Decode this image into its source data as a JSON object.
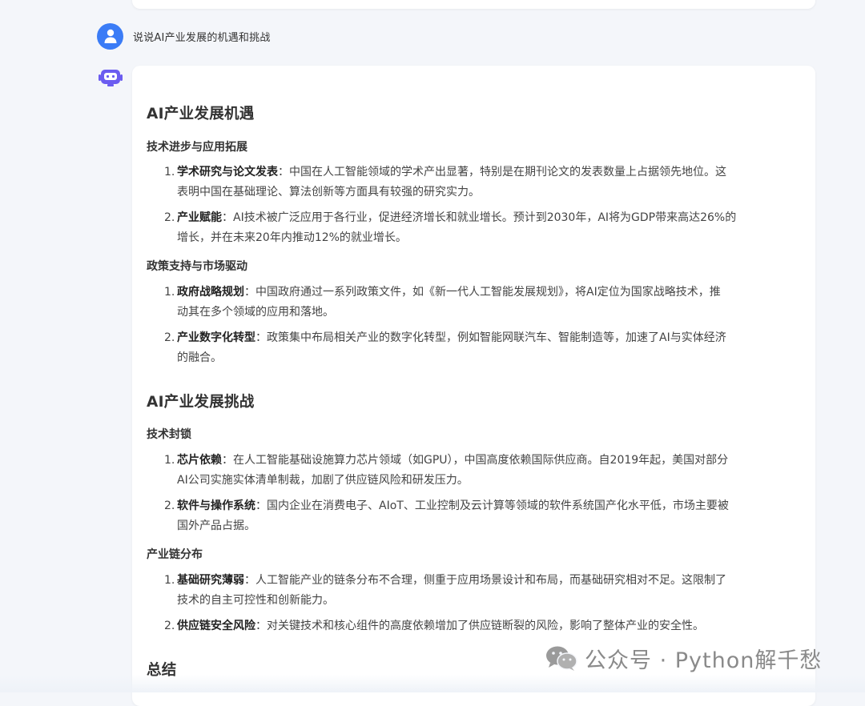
{
  "user_message": "说说AI产业发展的机遇和挑战",
  "answer": {
    "section1_title": "AI产业发展机遇",
    "sub1": "技术进步与应用拓展",
    "s1_i1_bold": "学术研究与论文发表",
    "s1_i1_l1": "：中国在人工智能领域的学术产出显著，特别是在期刊论文的发表数量上占据领先地位。这",
    "s1_i1_l2": "表明中国在基础理论、算法创新等方面具有较强的研究实力。",
    "s1_i2_bold": "产业赋能",
    "s1_i2_l1": "：AI技术被广泛应用于各行业，促进经济增长和就业增长。预计到2030年，AI将为GDP带来高达26%的",
    "s1_i2_l2": "增长，并在未来20年内推动12%的就业增长。",
    "sub2": "政策支持与市场驱动",
    "s2_i1_bold": "政府战略规划",
    "s2_i1_l1": "：中国政府通过一系列政策文件，如《新一代人工智能发展规划》，将AI定位为国家战略技术，推",
    "s2_i1_l2": "动其在多个领域的应用和落地。",
    "s2_i2_bold": "产业数字化转型",
    "s2_i2_l1": "：政策集中布局相关产业的数字化转型，例如智能网联汽车、智能制造等，加速了AI与实体经济",
    "s2_i2_l2": "的融合。",
    "section2_title": "AI产业发展挑战",
    "sub3": "技术封锁",
    "s3_i1_bold": "芯片依赖",
    "s3_i1_l1": "：在人工智能基础设施算力芯片领域（如GPU），中国高度依赖国际供应商。自2019年起，美国对部分",
    "s3_i1_l2": "AI公司实施实体清单制裁，加剧了供应链风险和研发压力。",
    "s3_i2_bold": "软件与操作系统",
    "s3_i2_l1": "：国内企业在消费电子、AIoT、工业控制及云计算等领域的软件系统国产化水平低，市场主要被",
    "s3_i2_l2": "国外产品占据。",
    "sub4": "产业链分布",
    "s4_i1_bold": "基础研究薄弱",
    "s4_i1_l1": "：人工智能产业的链条分布不合理，侧重于应用场景设计和布局，而基础研究相对不足。这限制了",
    "s4_i1_l2": "技术的自主可控性和创新能力。",
    "s4_i2_bold": "供应链安全风险",
    "s4_i2_l1": "：对关键技术和核心组件的高度依赖增加了供应链断裂的风险，影响了整体产业的安全性。",
    "section3_title": "总结",
    "num1": "1.",
    "num2": "2."
  },
  "watermark": "公众号 · Python解千愁",
  "colors": {
    "avatar": "#3b7cf6",
    "bot": "#6b5cf0",
    "card": "#ffffff",
    "background": "#f4f6fa"
  }
}
